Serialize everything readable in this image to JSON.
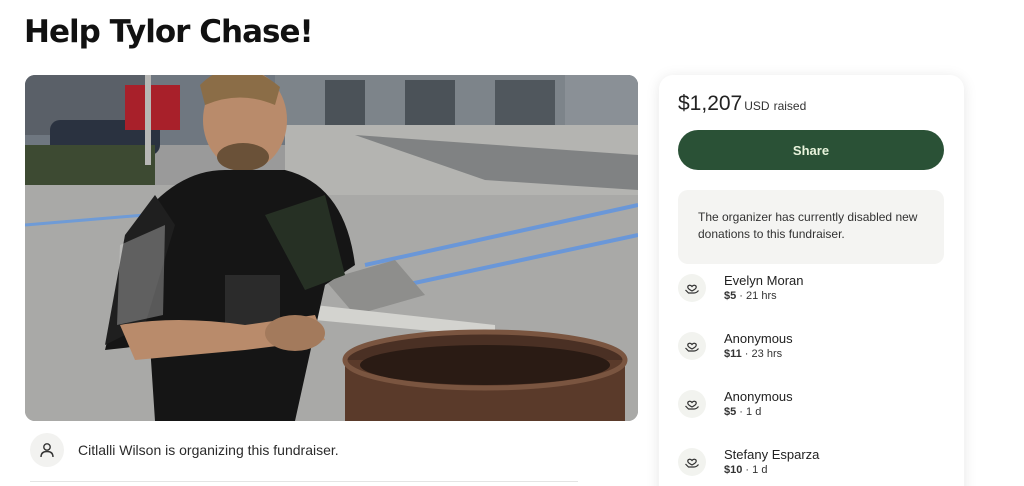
{
  "page": {
    "title": "Help Tylor Chase!"
  },
  "organizer": {
    "text": "Citlalli Wilson is organizing this fundraiser.",
    "icon": "user-icon"
  },
  "donation_card": {
    "raised_amount": "$1,207",
    "raised_currency": "USD",
    "raised_label": "raised",
    "share_label": "Share",
    "notice": "The organizer has currently disabled new donations to this fundraiser.",
    "donations": [
      {
        "name": "Evelyn Moran",
        "amount": "$5",
        "separator": " · ",
        "time": "21 hrs",
        "icon": "heart-hand-icon"
      },
      {
        "name": "Anonymous",
        "amount": "$11",
        "separator": " · ",
        "time": "23 hrs",
        "icon": "heart-hand-icon"
      },
      {
        "name": "Anonymous",
        "amount": "$5",
        "separator": " · ",
        "time": "1 d",
        "icon": "heart-hand-icon"
      },
      {
        "name": "Stefany Esparza",
        "amount": "$10",
        "separator": " · ",
        "time": "1 d",
        "icon": "heart-hand-icon"
      }
    ]
  },
  "colors": {
    "share_button": "#2a5136",
    "share_text": "#e8f3dc",
    "notice_bg": "#f4f4f2"
  }
}
